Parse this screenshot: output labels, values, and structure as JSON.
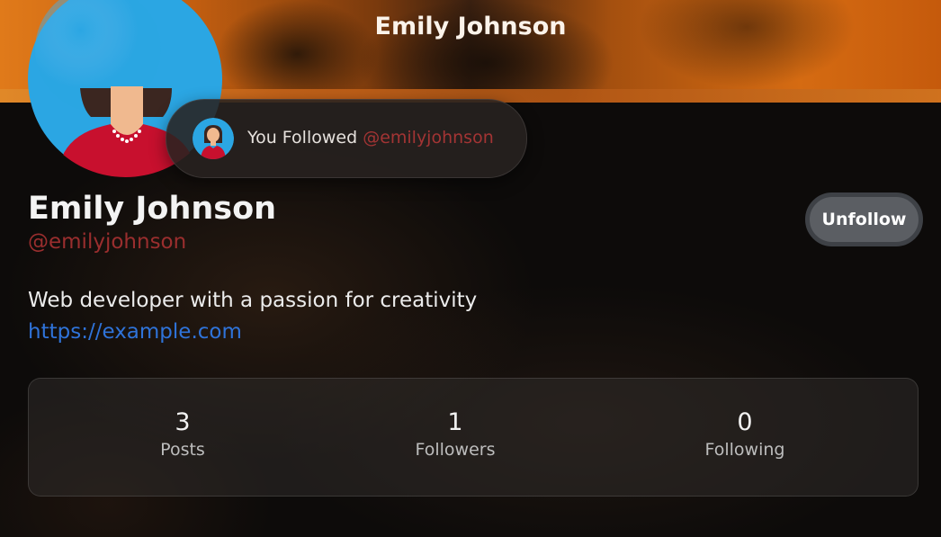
{
  "banner": {
    "title": "Emily Johnson"
  },
  "toast": {
    "prefix": "You Followed",
    "handle": "@emilyjohnson"
  },
  "profile": {
    "name": "Emily Johnson",
    "handle": "@emilyjohnson",
    "bio": "Web developer with a passion for creativity",
    "link": "https://example.com",
    "unfollow_label": "Unfollow"
  },
  "stats": [
    {
      "value": "3",
      "label": "Posts"
    },
    {
      "value": "1",
      "label": "Followers"
    },
    {
      "value": "0",
      "label": "Following"
    }
  ],
  "icons": {
    "avatar": "woman-avatar-icon"
  },
  "colors": {
    "accent_handle": "#9a2e2e",
    "link": "#2f73d9",
    "button": "#5b5e63",
    "banner_orange": "#e07a1a"
  }
}
